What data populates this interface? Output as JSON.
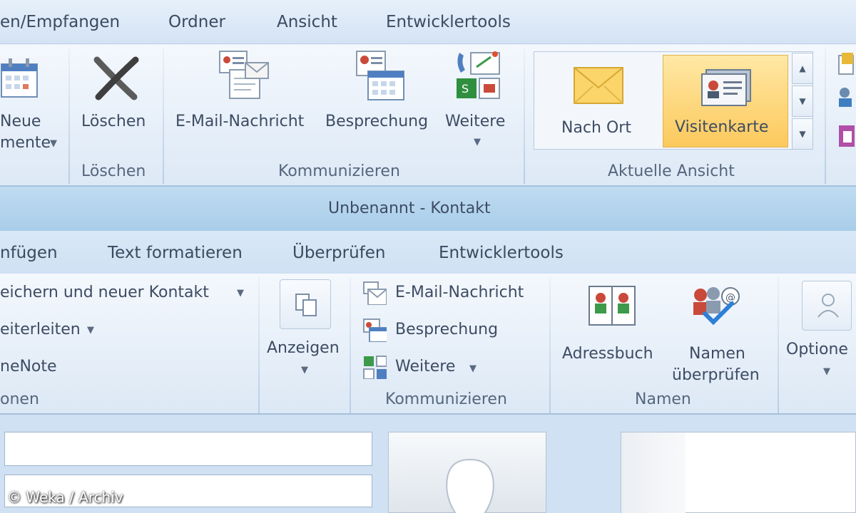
{
  "main_window": {
    "tabs": [
      "en/Empfangen",
      "Ordner",
      "Ansicht",
      "Entwicklertools"
    ],
    "ribbon": {
      "new_items": {
        "label_line1": "Neue",
        "label_line2": "mente"
      },
      "delete": {
        "button_label": "Löschen",
        "group_label": "Löschen"
      },
      "communicate": {
        "buttons": [
          "E-Mail-Nachricht",
          "Besprechung",
          "Weitere"
        ],
        "group_label": "Kommunizieren"
      },
      "current_view": {
        "items": [
          "Nach Ort",
          "Visitenkarte"
        ],
        "selected": "Visitenkarte",
        "group_label": "Aktuelle Ansicht"
      }
    }
  },
  "contact_window": {
    "title": "Unbenannt - Kontakt",
    "tabs": [
      "nfügen",
      "Text formatieren",
      "Überprüfen",
      "Entwicklertools"
    ],
    "ribbon": {
      "actions": {
        "items": [
          "eichern und neuer Kontakt",
          "eiterleiten",
          "neNote"
        ],
        "group_label": "onen"
      },
      "show": {
        "label": "Anzeigen"
      },
      "communicate": {
        "items": [
          "E-Mail-Nachricht",
          "Besprechung",
          "Weitere"
        ],
        "group_label": "Kommunizieren"
      },
      "names": {
        "buttons": [
          "Adressbuch",
          "Namen überprüfen"
        ],
        "check_line1": "Namen",
        "check_line2": "überprüfen",
        "group_label": "Namen"
      },
      "options": {
        "label": "Optione"
      }
    }
  },
  "watermark": "© Weka / Archiv",
  "colors": {
    "selected_gallery": "#fcc95c",
    "ribbon_bg": "#e8f0f9",
    "title_bar": "#b3d4ec"
  }
}
